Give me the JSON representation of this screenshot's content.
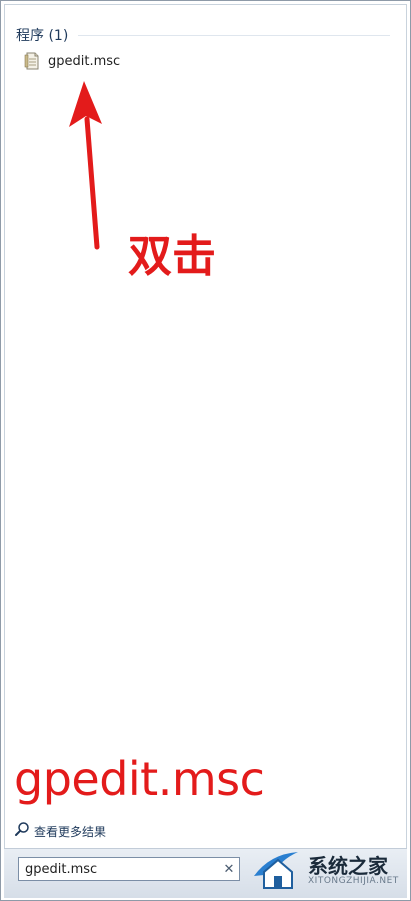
{
  "results": {
    "section_header": "程序 (1)",
    "program_item": {
      "label": "gpedit.msc",
      "icon": "msc-file-icon"
    }
  },
  "annotations": {
    "double_click": "双击",
    "command": "gpedit.msc",
    "color": "#e31b1b"
  },
  "see_more": {
    "label": "查看更多结果",
    "icon": "search-icon"
  },
  "search": {
    "value": "gpedit.msc",
    "clear_icon": "close-icon"
  },
  "watermark": {
    "title": "系统之家",
    "subtitle": "XITONGZHIJIA.NET"
  }
}
